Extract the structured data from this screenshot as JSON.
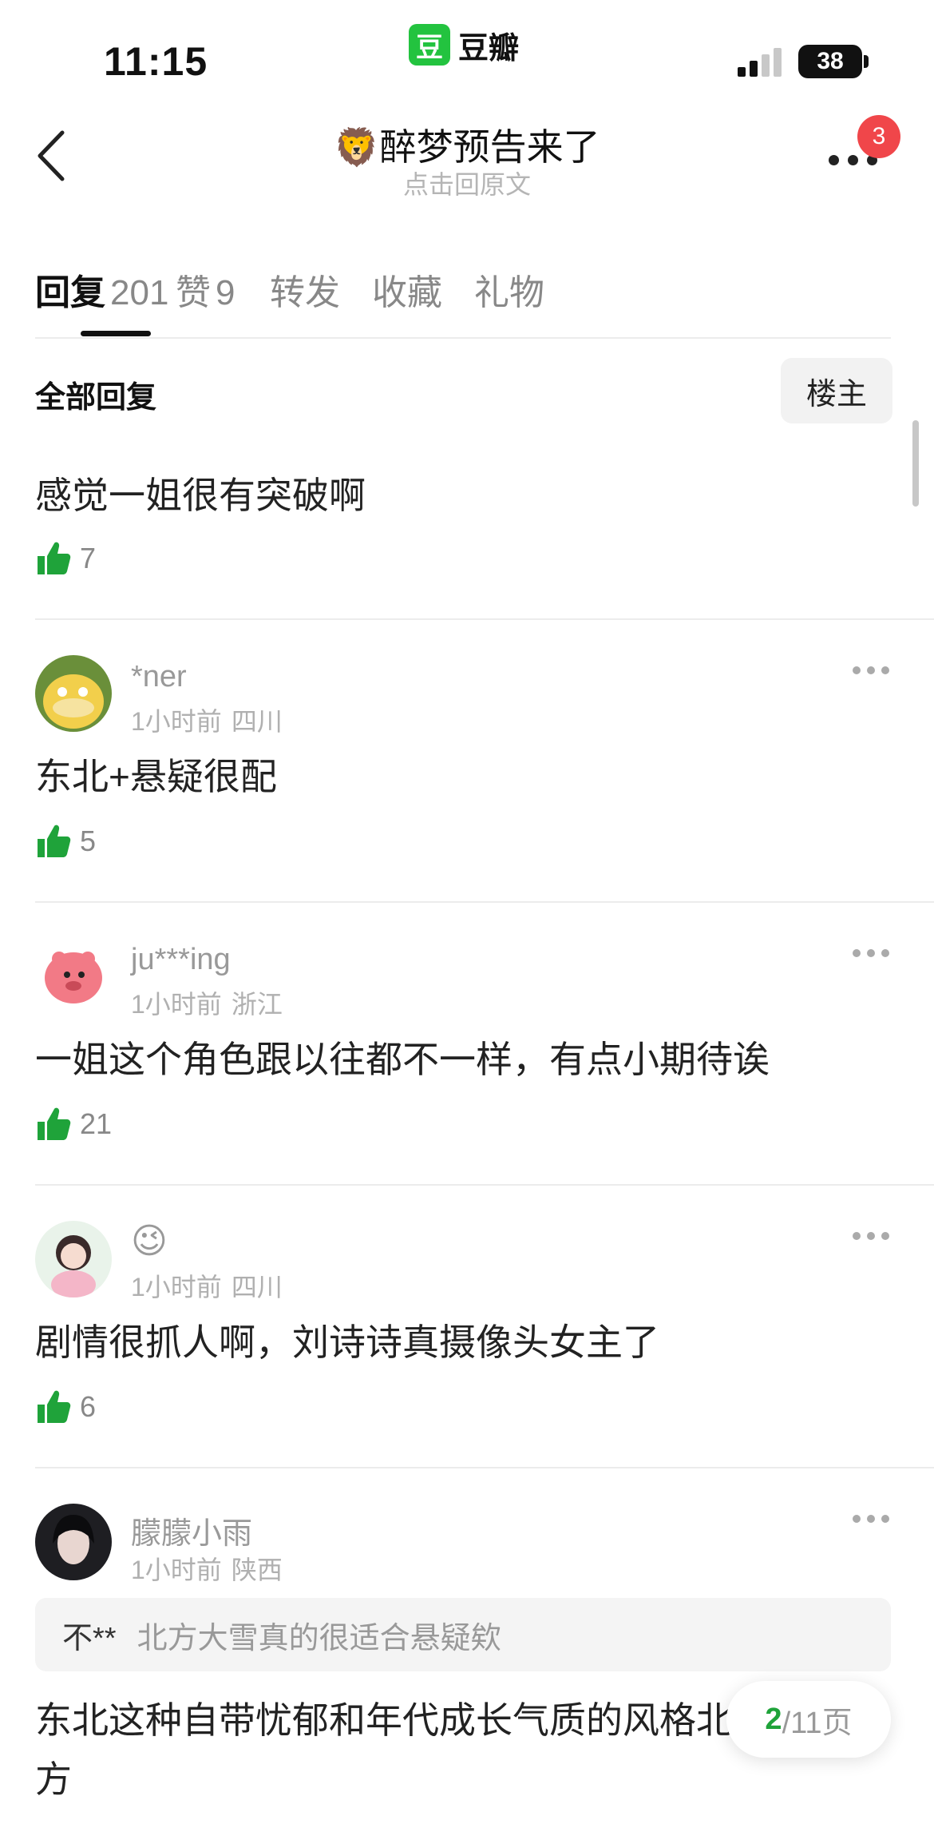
{
  "status_bar": {
    "time": "11:15",
    "app_name": "豆瓣",
    "app_logo_char": "豆",
    "battery": "38"
  },
  "header": {
    "title": "🦁醉梦预告来了",
    "subtitle": "点击回原文",
    "notification_count": "3"
  },
  "tabs": [
    {
      "label": "回复",
      "count": "201",
      "active": true
    },
    {
      "label": "赞",
      "count": "9",
      "active": false
    },
    {
      "label": "转发",
      "count": "",
      "active": false
    },
    {
      "label": "收藏",
      "count": "",
      "active": false
    },
    {
      "label": "礼物",
      "count": "",
      "active": false
    }
  ],
  "filter": {
    "section_label": "全部回复",
    "op_button": "楼主"
  },
  "first_comment": {
    "text": "感觉一姐很有突破啊",
    "likes": "7"
  },
  "comments": [
    {
      "username": "*ner",
      "time": "1小时前",
      "location": "四川",
      "text": "东北+悬疑很配",
      "likes": "5"
    },
    {
      "username": "ju***ing",
      "time": "1小时前",
      "location": "浙江",
      "text": "一姐这个角色跟以往都不一样，有点小期待诶",
      "likes": "21"
    },
    {
      "username": "😉",
      "time": "1小时前",
      "location": "四川",
      "text": "剧情很抓人啊，刘诗诗真摄像头女主了",
      "likes": "6"
    },
    {
      "username": "朦朦小雨",
      "time": "1小时前",
      "location": "陕西"
    }
  ],
  "last_comment": {
    "quote_user": "不**",
    "quote_text": "北方大雪真的很适合悬疑欸",
    "text": "东北这种自带忧郁和年代成长气质的风格北方"
  },
  "pagination": {
    "current": "2",
    "total_text": "/11页"
  },
  "colors": {
    "accent_green": "#23c33f",
    "badge_red": "#f0464a",
    "like_green": "#1fa33a"
  }
}
